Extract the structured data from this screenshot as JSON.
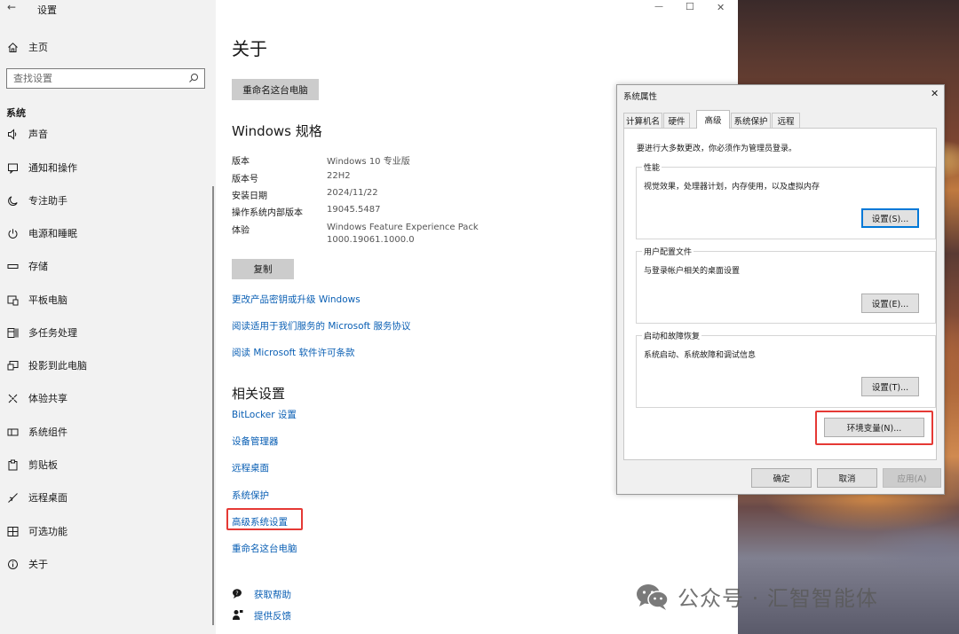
{
  "window": {
    "title": "设置",
    "back_glyph": "←",
    "min_glyph": "—",
    "max_glyph": "☐",
    "close_glyph": "✕"
  },
  "sidebar": {
    "home_label": "主页",
    "search_placeholder": "查找设置",
    "section_title": "系统",
    "items": [
      {
        "label": "声音",
        "icon": "speaker-icon"
      },
      {
        "label": "通知和操作",
        "icon": "notification-icon"
      },
      {
        "label": "专注助手",
        "icon": "moon-icon"
      },
      {
        "label": "电源和睡眠",
        "icon": "power-icon"
      },
      {
        "label": "存储",
        "icon": "storage-icon"
      },
      {
        "label": "平板电脑",
        "icon": "tablet-icon"
      },
      {
        "label": "多任务处理",
        "icon": "multitasking-icon"
      },
      {
        "label": "投影到此电脑",
        "icon": "projection-icon"
      },
      {
        "label": "体验共享",
        "icon": "share-icon"
      },
      {
        "label": "系统组件",
        "icon": "components-icon"
      },
      {
        "label": "剪贴板",
        "icon": "clipboard-icon"
      },
      {
        "label": "远程桌面",
        "icon": "remote-desktop-icon"
      },
      {
        "label": "可选功能",
        "icon": "optional-features-icon"
      },
      {
        "label": "关于",
        "icon": "info-icon"
      }
    ]
  },
  "main": {
    "page_title": "关于",
    "rename_button": "重命名这台电脑",
    "specs_title": "Windows 规格",
    "specs": [
      {
        "key": "版本",
        "value": "Windows 10 专业版"
      },
      {
        "key": "版本号",
        "value": "22H2"
      },
      {
        "key": "安装日期",
        "value": "2024/11/22"
      },
      {
        "key": "操作系统内部版本",
        "value": "19045.5487"
      },
      {
        "key": "体验",
        "value": "Windows Feature Experience Pack",
        "value2": "1000.19061.1000.0"
      }
    ],
    "copy_button": "复制",
    "links": [
      "更改产品密钥或升级 Windows",
      "阅读适用于我们服务的 Microsoft 服务协议",
      "阅读 Microsoft 软件许可条款"
    ],
    "related_title": "相关设置",
    "related_links": [
      "BitLocker 设置",
      "设备管理器",
      "远程桌面",
      "系统保护",
      "高级系统设置",
      "重命名这台电脑"
    ],
    "help_label": "获取帮助",
    "feedback_label": "提供反馈"
  },
  "dialog": {
    "title": "系统属性",
    "close_glyph": "✕",
    "tabs": [
      "计算机名",
      "硬件",
      "高级",
      "系统保护",
      "远程"
    ],
    "active_tab": "高级",
    "admin_note": "要进行大多数更改，你必须作为管理员登录。",
    "groups": [
      {
        "title": "性能",
        "desc": "视觉效果，处理器计划，内存使用，以及虚拟内存",
        "button": "设置(S)..."
      },
      {
        "title": "用户配置文件",
        "desc": "与登录帐户相关的桌面设置",
        "button": "设置(E)..."
      },
      {
        "title": "启动和故障恢复",
        "desc": "系统启动、系统故障和调试信息",
        "button": "设置(T)..."
      }
    ],
    "env_button": "环境变量(N)...",
    "ok_button": "确定",
    "cancel_button": "取消",
    "apply_button": "应用(A)"
  },
  "watermark": {
    "text": "公众号 · 汇智智能体"
  },
  "colors": {
    "link": "#0a5fb4",
    "highlight": "#e53935",
    "sidebar_bg": "#f2f2f2",
    "button_gray": "#cccccc"
  }
}
